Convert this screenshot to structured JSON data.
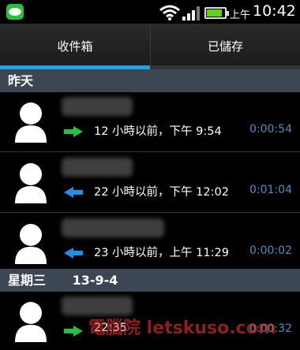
{
  "status_bar": {
    "ampm": "上午",
    "time": "10:42",
    "battery_level": 0.85,
    "icons": [
      "line-app-icon",
      "wifi-icon",
      "signal-icon",
      "battery-icon"
    ]
  },
  "tabs": [
    {
      "label": "收件箱",
      "selected": true
    },
    {
      "label": "已儲存",
      "selected": false
    }
  ],
  "sections": [
    {
      "header": "昨天",
      "date": "",
      "items": [
        {
          "direction": "outgoing",
          "arrow_color": "#22c33a",
          "when": "12 小時以前，下午 9:54",
          "duration": "0:00:54"
        },
        {
          "direction": "incoming",
          "arrow_color": "#1e90e6",
          "when": "22 小時以前，下午 12:02",
          "duration": "0:01:04"
        },
        {
          "direction": "incoming",
          "arrow_color": "#1e90e6",
          "when": "23 小時以前，上午 11:29",
          "duration": "0:00:02"
        }
      ]
    },
    {
      "header": "星期三",
      "date": "13-9-4",
      "items": [
        {
          "direction": "outgoing",
          "arrow_color": "#22c33a",
          "when": "22:35",
          "duration": "0:00:32"
        }
      ]
    }
  ],
  "watermark": "電腦院 letskuso.com"
}
